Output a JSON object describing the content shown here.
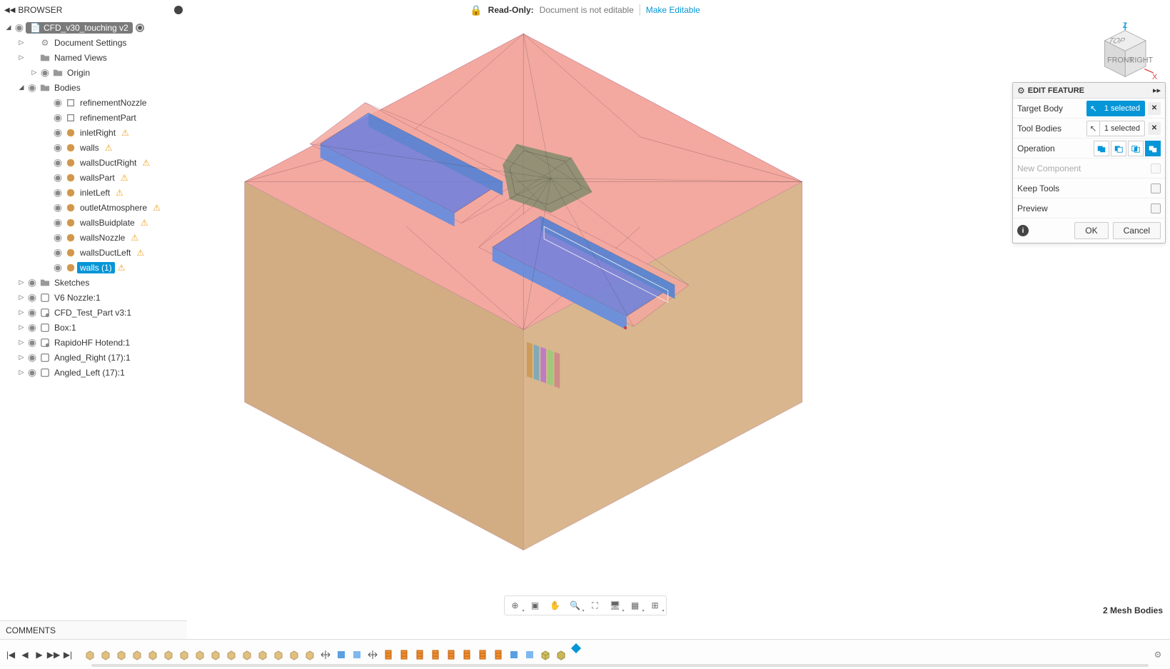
{
  "topbar": {
    "browser_label": "BROWSER",
    "readonly_label": "Read-Only:",
    "readonly_msg": "Document is not editable",
    "make_editable": "Make Editable"
  },
  "tree": {
    "root": "CFD_v30_touching v2",
    "items": [
      {
        "depth": 1,
        "caret": "right",
        "icon": "gear",
        "label": "Document Settings"
      },
      {
        "depth": 1,
        "caret": "right",
        "icon": "folder",
        "label": "Named Views"
      },
      {
        "depth": 2,
        "caret": "right",
        "icon": "folder",
        "label": "Origin",
        "vis": true
      },
      {
        "depth": 1,
        "caret": "down",
        "icon": "folder",
        "label": "Bodies",
        "vis": true
      },
      {
        "depth": 3,
        "caret": "",
        "icon": "body",
        "label": "refinementNozzle",
        "vis": true
      },
      {
        "depth": 3,
        "caret": "",
        "icon": "body",
        "label": "refinementPart",
        "vis": true
      },
      {
        "depth": 3,
        "caret": "",
        "icon": "mesh",
        "label": "inletRight",
        "vis": true,
        "warn": true
      },
      {
        "depth": 3,
        "caret": "",
        "icon": "mesh",
        "label": "walls",
        "vis": true,
        "warn": true
      },
      {
        "depth": 3,
        "caret": "",
        "icon": "mesh",
        "label": "wallsDuctRight",
        "vis": true,
        "warn": true
      },
      {
        "depth": 3,
        "caret": "",
        "icon": "mesh",
        "label": "wallsPart",
        "vis": true,
        "warn": true
      },
      {
        "depth": 3,
        "caret": "",
        "icon": "mesh",
        "label": "inletLeft",
        "vis": true,
        "warn": true
      },
      {
        "depth": 3,
        "caret": "",
        "icon": "mesh",
        "label": "outletAtmosphere",
        "vis": true,
        "warn": true
      },
      {
        "depth": 3,
        "caret": "",
        "icon": "mesh",
        "label": "wallsBuidplate",
        "vis": true,
        "warn": true
      },
      {
        "depth": 3,
        "caret": "",
        "icon": "mesh",
        "label": "wallsNozzle",
        "vis": true,
        "warn": true
      },
      {
        "depth": 3,
        "caret": "",
        "icon": "mesh",
        "label": "wallsDuctLeft",
        "vis": true,
        "warn": true
      },
      {
        "depth": 3,
        "caret": "",
        "icon": "mesh",
        "label": "walls (1)",
        "vis": true,
        "warn": true,
        "selected": true
      },
      {
        "depth": 1,
        "caret": "right",
        "icon": "folder",
        "label": "Sketches",
        "vis": true
      },
      {
        "depth": 1,
        "caret": "right",
        "icon": "comp",
        "label": "V6 Nozzle:1",
        "vis": true
      },
      {
        "depth": 1,
        "caret": "right",
        "icon": "comp-link",
        "label": "CFD_Test_Part v3:1",
        "vis": true
      },
      {
        "depth": 1,
        "caret": "right",
        "icon": "comp",
        "label": "Box:1",
        "vis": true
      },
      {
        "depth": 1,
        "caret": "right",
        "icon": "comp-link",
        "label": "RapidoHF Hotend:1",
        "vis": true
      },
      {
        "depth": 1,
        "caret": "right",
        "icon": "comp",
        "label": "Angled_Right (17):1",
        "vis": true
      },
      {
        "depth": 1,
        "caret": "right",
        "icon": "comp",
        "label": "Angled_Left (17):1",
        "vis": true
      }
    ]
  },
  "comments": {
    "label": "COMMENTS"
  },
  "feature_panel": {
    "title": "EDIT FEATURE",
    "rows": {
      "target_body": "Target Body",
      "tool_bodies": "Tool Bodies",
      "operation": "Operation",
      "new_component": "New Component",
      "keep_tools": "Keep Tools",
      "preview": "Preview"
    },
    "selected1": "1 selected",
    "selected2": "1 selected",
    "ok": "OK",
    "cancel": "Cancel"
  },
  "viewcube": {
    "front": "FRONT",
    "right": "RIGHT",
    "top": "TOP"
  },
  "status": {
    "mesh_bodies": "2 Mesh Bodies"
  },
  "colors": {
    "accent": "#0696d7",
    "box_top": "#f3a9a0",
    "box_side1": "#d9b68e",
    "box_side2": "#d2ad83",
    "duct_blue": "#6e7fe0",
    "duct_blue2": "#4a7fd8"
  }
}
